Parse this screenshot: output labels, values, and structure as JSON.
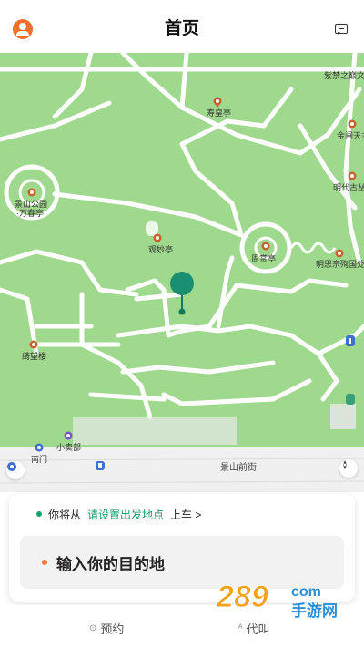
{
  "header": {
    "title": "首页"
  },
  "icons": {
    "avatar": "user-avatar-icon",
    "message": "message-icon",
    "locate": "locate-icon",
    "compass": "compass-icon"
  },
  "map": {
    "pois": [
      {
        "label": "紫禁之巅文创"
      },
      {
        "label": "寿皇亭"
      },
      {
        "label": "金闸天主"
      },
      {
        "label": "明代古丛"
      },
      {
        "label": "景山公园"
      },
      {
        "label": "·万春亭"
      },
      {
        "label": "观妙亭"
      },
      {
        "label": "周赏亭"
      },
      {
        "label": "明思宗殉国处"
      },
      {
        "label": "绮望楼"
      },
      {
        "label": "小卖部"
      },
      {
        "label": "南门"
      }
    ],
    "street": "景山前街"
  },
  "trip": {
    "from_prefix": "你将从",
    "from_link": "请设置出发地点",
    "from_suffix": "上车 >",
    "destination_placeholder": "输入你的目的地"
  },
  "bottom_nav": {
    "reserve": "预约",
    "call_for_others": "代叫"
  },
  "watermark": {
    "number": "289",
    "suffix": "com",
    "site": "手游网"
  },
  "colors": {
    "accent_green": "#17a36c",
    "map_green": "#9fd98d",
    "orange": "#f07a3a"
  }
}
